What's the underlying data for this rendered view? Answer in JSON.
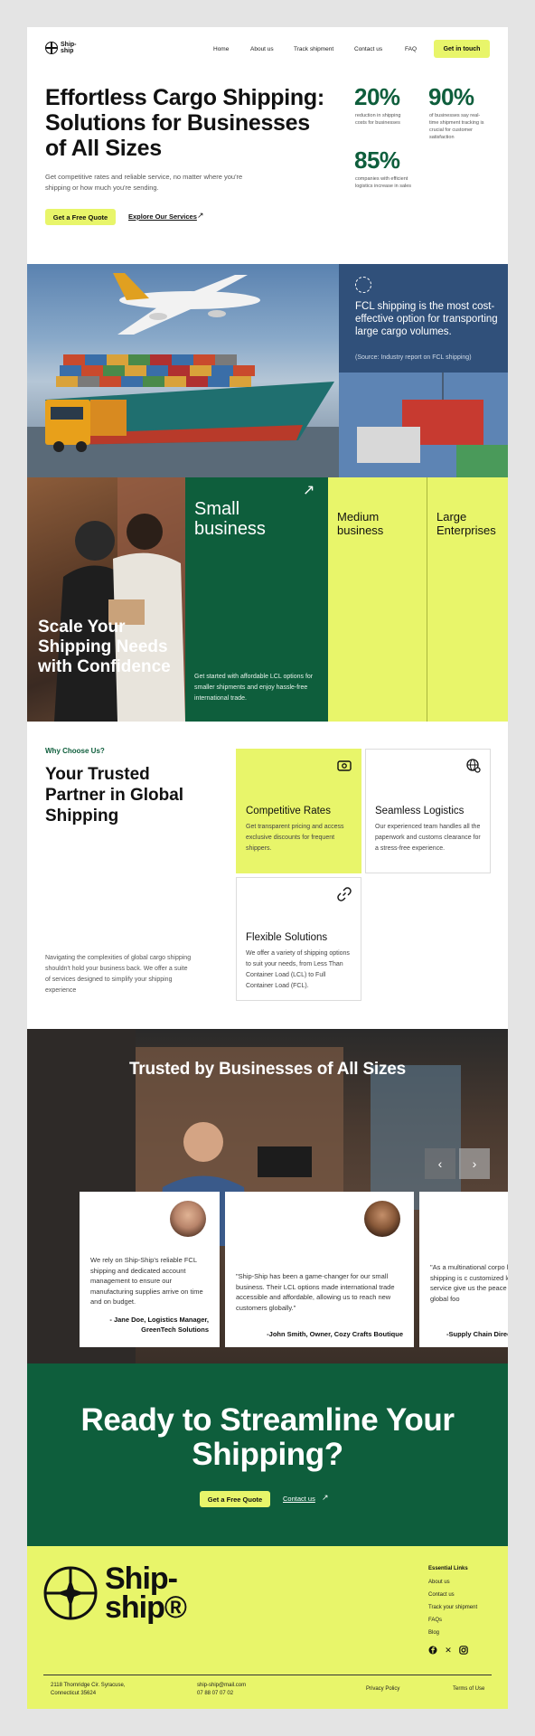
{
  "brand": {
    "logo_text": "Ship-ship",
    "footer_logo_text": "Ship-ship®"
  },
  "nav": {
    "links": [
      "Home",
      "About us",
      "Track shipment",
      "Contact us",
      "FAQ"
    ],
    "cta": "Get in touch"
  },
  "hero": {
    "title": "Effortless Cargo Shipping: Solutions for Businesses of All Sizes",
    "subtitle": "Get competitive rates and reliable service, no matter where you're shipping or how much you're sending.",
    "primary_cta": "Get a Free Quote",
    "secondary_cta": "Explore Our Services",
    "stats": [
      {
        "value": "20%",
        "desc": "reduction in shipping costs for businesses"
      },
      {
        "value": "90%",
        "desc": "of businesses say real-time shipment tracking is crucial for customer satisfaction"
      },
      {
        "value": "85%",
        "desc": "companies with efficient logistics increase in sales"
      }
    ]
  },
  "fcl": {
    "text": "FCL shipping is the most cost-effective option for transporting large cargo volumes.",
    "source": "(Source: Industry report on FCL shipping)"
  },
  "segments": {
    "photo_title": "Scale Your Shipping Needs with Confidence",
    "small_title": "Small business",
    "small_desc": "Get started with affordable LCL options for smaller shipments and enjoy hassle-free international trade.",
    "medium_title": "Medium business",
    "large_title": "Large Enterprises"
  },
  "why": {
    "kicker": "Why Choose Us?",
    "title": "Your Trusted Partner in Global Shipping",
    "desc": "Navigating the complexities of global cargo shipping shouldn't hold your business back. We offer a suite of services designed to simplify your shipping experience",
    "cards": [
      {
        "title": "Competitive Rates",
        "desc": "Get transparent pricing and access exclusive discounts for frequent shippers.",
        "icon": "money-icon"
      },
      {
        "title": "Seamless Logistics",
        "desc": "Our experienced team handles all the paperwork and customs clearance for a stress-free experience.",
        "icon": "globe-gear-icon"
      },
      {
        "title": "Flexible Solutions",
        "desc": "We offer a variety of shipping options to suit your needs, from Less Than Container Load (LCL) to Full Container Load (FCL).",
        "icon": "link-icon"
      }
    ]
  },
  "testimonials": {
    "title": "Trusted by Businesses of All Sizes",
    "items": [
      {
        "quote": "We rely on Ship-Ship's reliable FCL shipping and dedicated account management to ensure our manufacturing supplies arrive on time and on budget.",
        "name": "- Jane Doe, Logistics Manager, GreenTech Solutions"
      },
      {
        "quote": "\"Ship-Ship has been a game-changer for our small business. Their LCL options made international trade accessible and affordable, allowing us to reach new customers globally.\"",
        "name": "-John Smith, Owner, Cozy Crafts Boutique"
      },
      {
        "quote": "\"As a multinational corpo high-volume shipping is c customized logistics solu service give us the peace expanding our global foo",
        "name": "-Supply Chain Direc"
      }
    ]
  },
  "cta": {
    "title": "Ready to Streamline Your Shipping?",
    "primary": "Get a Free Quote",
    "secondary": "Contact us"
  },
  "footer": {
    "links_title": "Essential Links",
    "links": [
      "About us",
      "Contact us",
      "Track your shipment",
      "FAQs",
      "Blog"
    ],
    "address": "2118 Thornridge Cir. Syracuse, Connecticut 35624",
    "email": "ship-ship@mail.com",
    "phone": "07 88 07 07 02",
    "privacy": "Privacy Policy",
    "terms": "Terms of Use"
  },
  "colors": {
    "accent_yellow": "#e8f56a",
    "brand_green": "#0e5e3c"
  }
}
